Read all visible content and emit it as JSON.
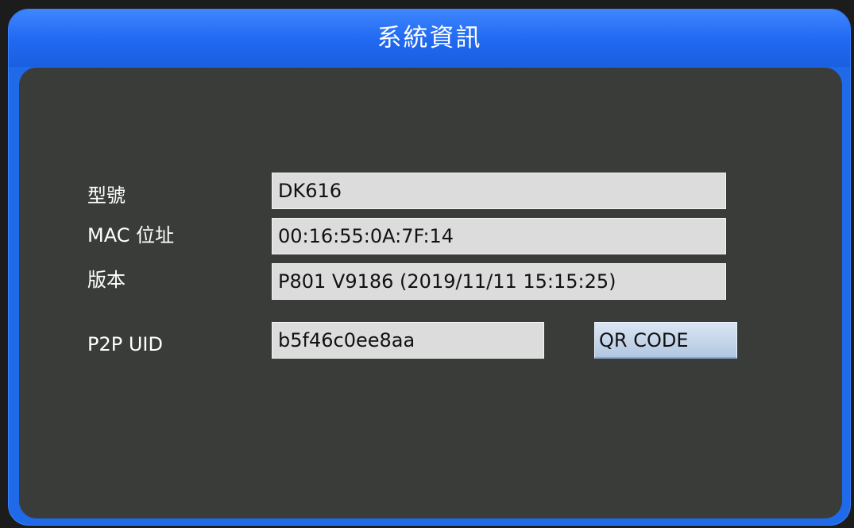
{
  "window": {
    "title": "系統資訊"
  },
  "fields": {
    "model": {
      "label": "型號",
      "value": "DK616"
    },
    "mac": {
      "label": "MAC 位址",
      "value": "00:16:55:0A:7F:14"
    },
    "version": {
      "label": "版本",
      "value": "P801 V9186 (2019/11/11 15:15:25)"
    },
    "p2p_uid": {
      "label": "P2P UID",
      "value": "b5f46c0ee8aa"
    }
  },
  "buttons": {
    "qr_code": "QR CODE"
  },
  "colors": {
    "title_bar": "#1f6ae8",
    "panel_background": "#3a3c3a",
    "field_background": "#dcdcdc",
    "button_background": "#c3d4e8",
    "label_text": "#ffffff"
  }
}
